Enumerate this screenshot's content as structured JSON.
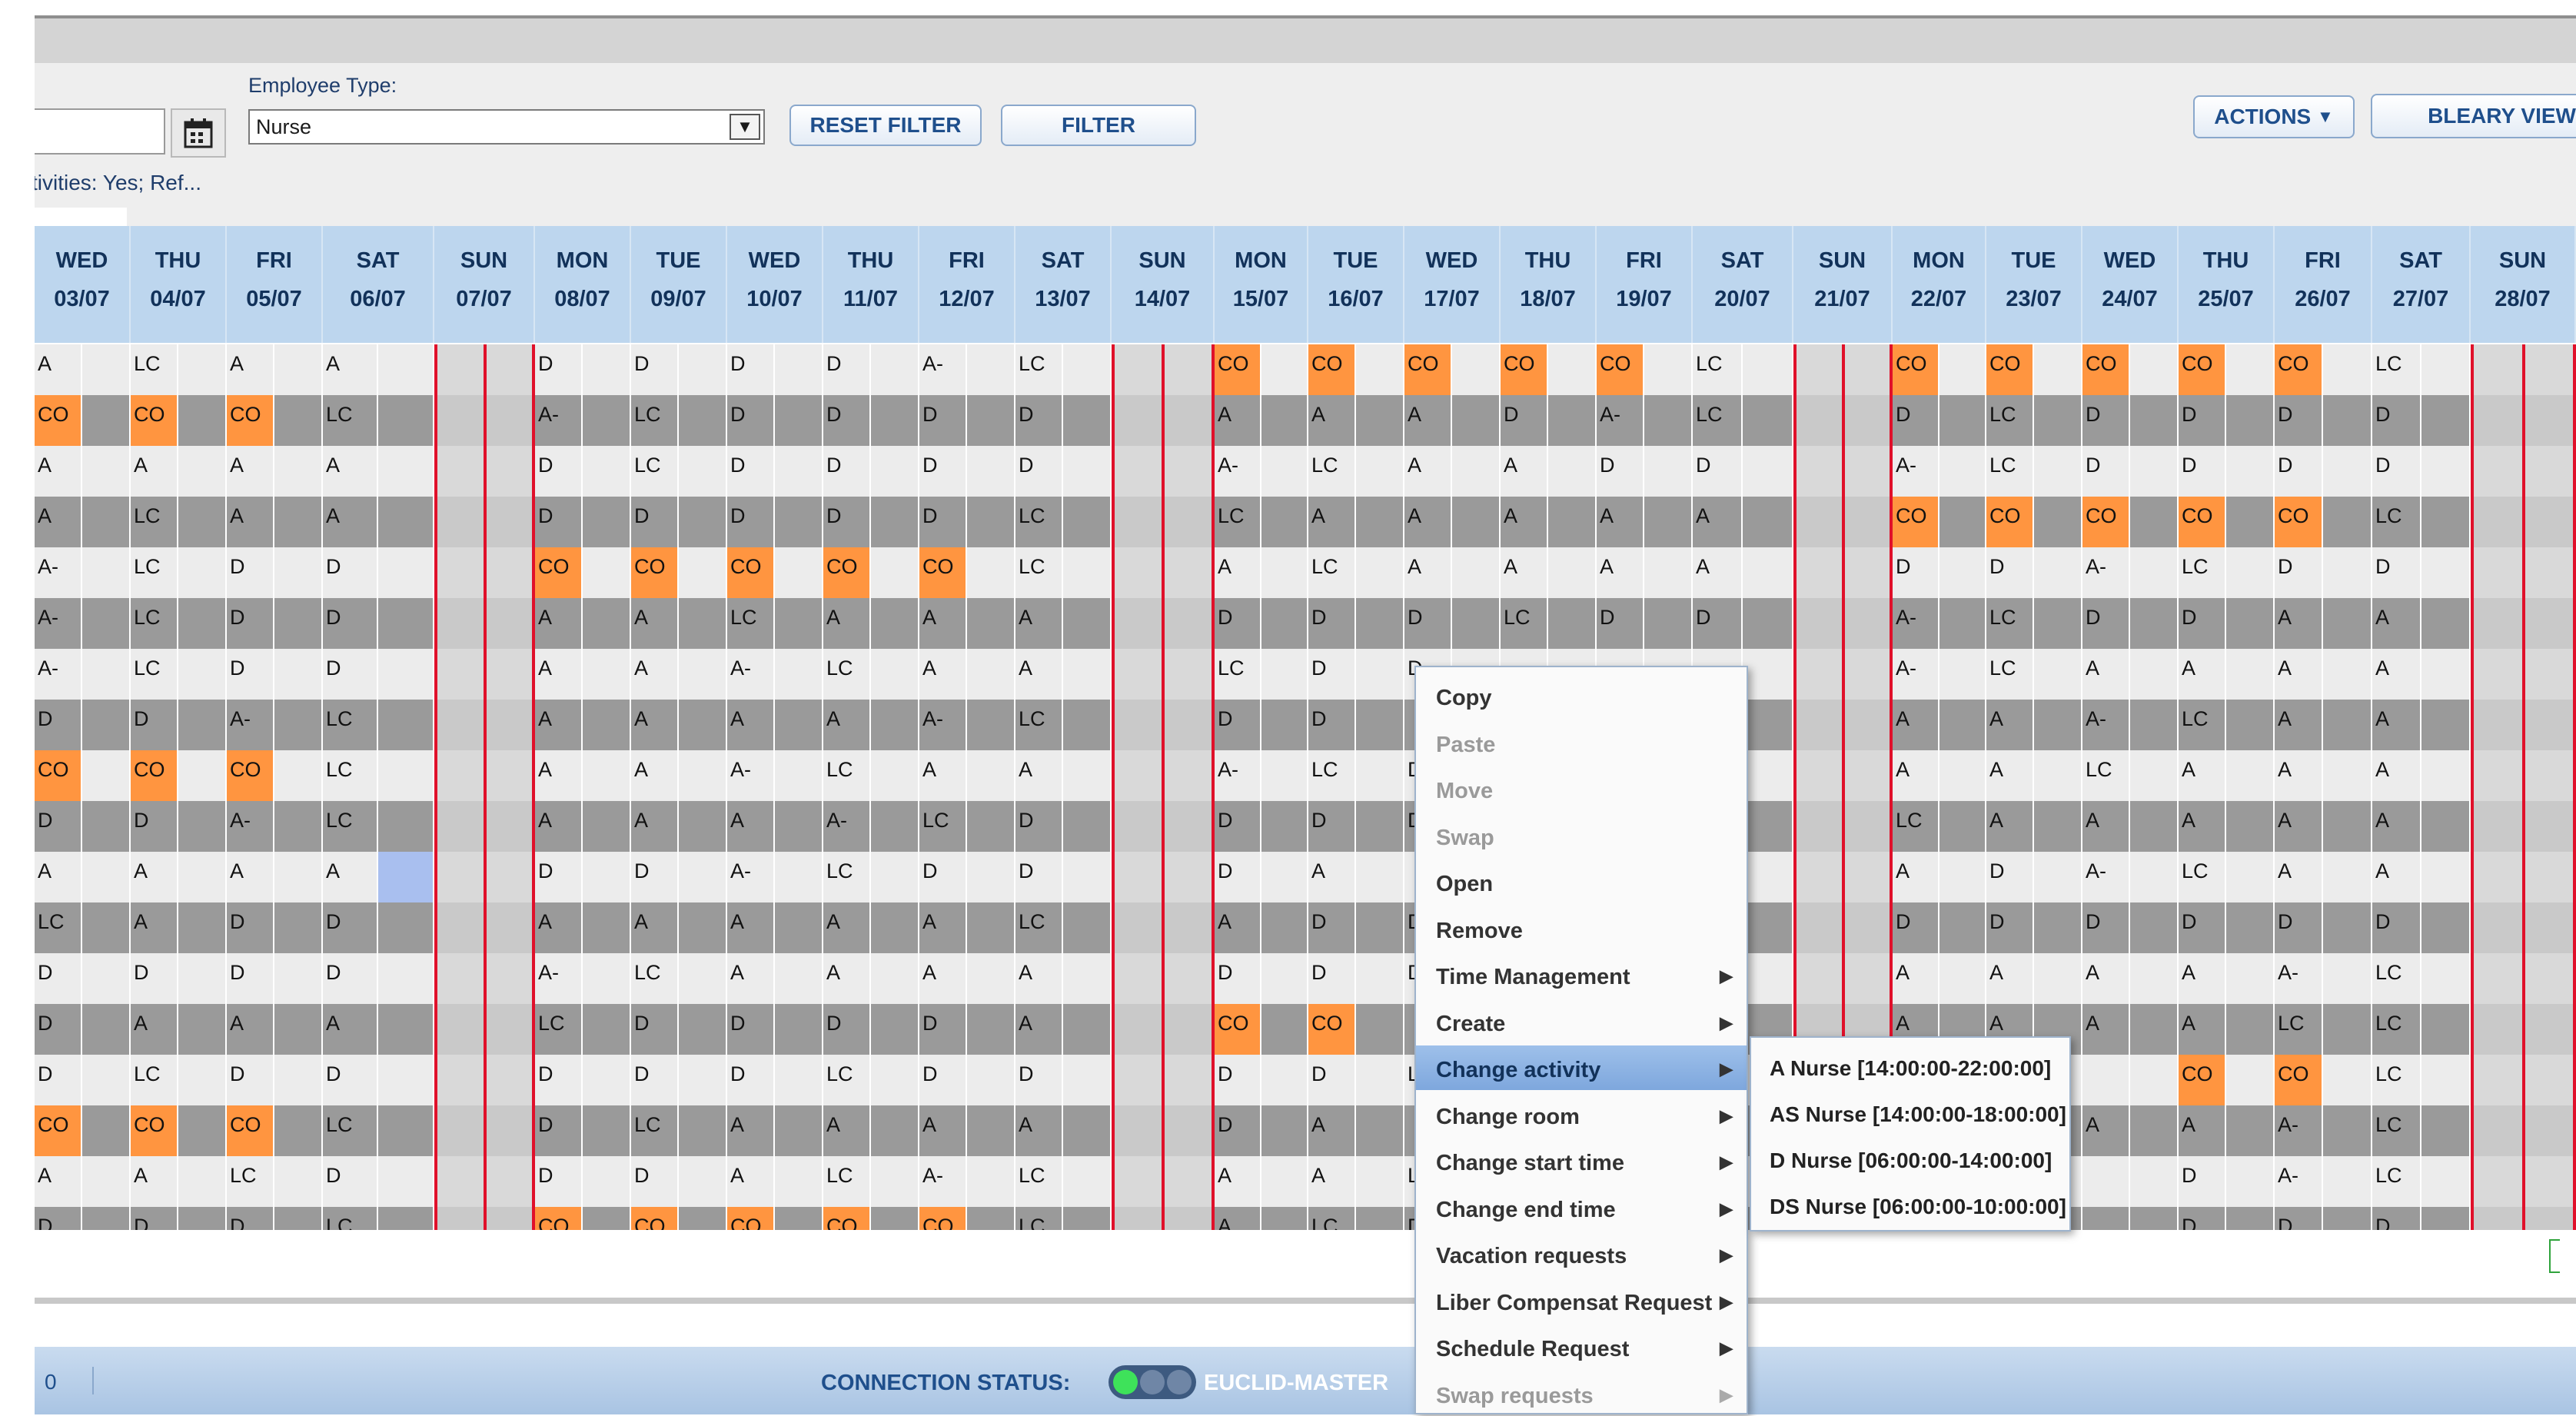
{
  "toolbar": {
    "employee_type_label": "Employee Type:",
    "employee_type_value": "Nurse",
    "reset_filter_label": "RESET FILTER",
    "filter_label": "FILTER",
    "actions_label": "ACTIONS",
    "bleary_view_label": "BLEARY VIEW",
    "filter_summary": "ctivities: Yes; Ref..."
  },
  "days": [
    {
      "dow": "WED",
      "date": "03/07"
    },
    {
      "dow": "THU",
      "date": "04/07"
    },
    {
      "dow": "FRI",
      "date": "05/07"
    },
    {
      "dow": "SAT",
      "date": "06/07"
    },
    {
      "dow": "SUN",
      "date": "07/07"
    },
    {
      "dow": "MON",
      "date": "08/07"
    },
    {
      "dow": "TUE",
      "date": "09/07"
    },
    {
      "dow": "WED",
      "date": "10/07"
    },
    {
      "dow": "THU",
      "date": "11/07"
    },
    {
      "dow": "FRI",
      "date": "12/07"
    },
    {
      "dow": "SAT",
      "date": "13/07"
    },
    {
      "dow": "SUN",
      "date": "14/07"
    },
    {
      "dow": "MON",
      "date": "15/07"
    },
    {
      "dow": "TUE",
      "date": "16/07"
    },
    {
      "dow": "WED",
      "date": "17/07"
    },
    {
      "dow": "THU",
      "date": "18/07"
    },
    {
      "dow": "FRI",
      "date": "19/07"
    },
    {
      "dow": "SAT",
      "date": "20/07"
    },
    {
      "dow": "SUN",
      "date": "21/07"
    },
    {
      "dow": "MON",
      "date": "22/07"
    },
    {
      "dow": "TUE",
      "date": "23/07"
    },
    {
      "dow": "WED",
      "date": "24/07"
    },
    {
      "dow": "THU",
      "date": "25/07"
    },
    {
      "dow": "FRI",
      "date": "26/07"
    },
    {
      "dow": "SAT",
      "date": "27/07"
    },
    {
      "dow": "SUN",
      "date": "28/07"
    }
  ],
  "schedule_rows": [
    [
      "  A",
      "LC",
      "  A",
      "  A",
      "",
      "D",
      "D",
      "D",
      "D",
      "A-",
      "LC",
      "",
      "CO",
      "CO",
      "CO",
      "CO",
      "CO",
      "LC",
      "",
      "CO",
      "CO",
      "CO",
      "CO",
      "CO",
      "LC",
      ""
    ],
    [
      "CO",
      "CO",
      "CO",
      "LC",
      "",
      "A-",
      "LC",
      "D",
      "D",
      "D",
      "D",
      "",
      "A",
      "A",
      "A",
      "D",
      "A-",
      "LC",
      "",
      "D",
      "LC",
      "D",
      "D",
      "D",
      "D",
      ""
    ],
    [
      "  A",
      "  A",
      "  A",
      "  A",
      "",
      "D",
      "LC",
      "D",
      "D",
      "D",
      "D",
      "",
      "A-",
      "LC",
      "A",
      "A",
      "D",
      "D",
      "",
      "A-",
      "LC",
      "D",
      "D",
      "D",
      "D",
      ""
    ],
    [
      "  A",
      "LC",
      "  A",
      "  A",
      "",
      "D",
      "D",
      "D",
      "D",
      "D",
      "LC",
      "",
      "LC",
      "A",
      "A",
      "A",
      "A",
      "A",
      "",
      "CO",
      "CO",
      "CO",
      "CO",
      "CO",
      "LC",
      ""
    ],
    [
      "A-",
      "LC",
      "D",
      "D",
      "",
      "CO",
      "CO",
      "CO",
      "CO",
      "CO",
      "LC",
      "",
      "A",
      "LC",
      "A",
      "A",
      "A",
      "A",
      "",
      "D",
      "D",
      "A-",
      "LC",
      "D",
      "D",
      ""
    ],
    [
      "A-",
      "LC",
      "D",
      "D",
      "",
      "A",
      "A",
      "LC",
      "A",
      "A",
      "A",
      "",
      "D",
      "D",
      "D",
      "LC",
      "D",
      "D",
      "",
      "A-",
      "LC",
      "D",
      "D",
      "A",
      "A",
      ""
    ],
    [
      "A-",
      "LC",
      "D",
      "D",
      "",
      "A",
      "A",
      "A-",
      "LC",
      "A",
      "A",
      "",
      "LC",
      "D",
      "D",
      "",
      "",
      "",
      "",
      "A-",
      "LC",
      "A",
      "A",
      "A",
      "A",
      ""
    ],
    [
      "D",
      "D",
      "A-",
      "LC",
      "",
      "A",
      "A",
      "A",
      "A",
      "A-",
      "LC",
      "",
      "D",
      "D",
      "",
      "",
      "",
      "",
      "",
      "A",
      "A",
      "A-",
      "LC",
      "A",
      "A",
      ""
    ],
    [
      "CO",
      "CO",
      "CO",
      "LC",
      "",
      "A",
      "A",
      "A-",
      "LC",
      "A",
      "A",
      "",
      "A-",
      "LC",
      "D",
      "",
      "",
      "",
      "",
      "A",
      "A",
      "LC",
      "A",
      "A",
      "A",
      ""
    ],
    [
      "D",
      "D",
      "A-",
      "LC",
      "",
      "A",
      "A",
      "A",
      "A-",
      "LC",
      "D",
      "",
      "D",
      "D",
      "D",
      "",
      "",
      "",
      "",
      "LC",
      "A",
      "A",
      "A",
      "A",
      "A",
      ""
    ],
    [
      "  A",
      "  A",
      "  A",
      "  A",
      "",
      "D",
      "D",
      "A-",
      "LC",
      "D",
      "D",
      "",
      "D",
      "A",
      "",
      "",
      "",
      "",
      "",
      "A",
      "D",
      "A-",
      "LC",
      "A",
      "A",
      ""
    ],
    [
      "  LC",
      "  A",
      "D",
      "D",
      "",
      "A",
      "A",
      "A",
      "A",
      "A",
      "LC",
      "",
      "A",
      "D",
      "D",
      "",
      "",
      "",
      "",
      "D",
      "D",
      "D",
      "D",
      "D",
      "D",
      ""
    ],
    [
      "D",
      "D",
      "D",
      "D",
      "",
      "A-",
      "LC",
      "A",
      "A",
      "A",
      "A",
      "",
      "D",
      "D",
      "D",
      "",
      "",
      "",
      "",
      "A",
      "A",
      "A",
      "A",
      "A-",
      "LC",
      ""
    ],
    [
      "D",
      "  A",
      "  A",
      "  A",
      "",
      "LC",
      "D",
      "D",
      "D",
      "D",
      "A",
      "",
      "CO",
      "CO",
      "",
      "",
      "",
      "",
      "",
      "A",
      "A",
      "A",
      "A",
      "LC",
      "LC",
      ""
    ],
    [
      "D",
      "LC",
      "D",
      "D",
      "",
      "D",
      "D",
      "D",
      "LC",
      "D",
      "D",
      "",
      "D",
      "D",
      "L",
      "",
      "",
      "",
      "",
      "",
      "",
      "",
      "CO",
      "CO",
      "LC",
      ""
    ],
    [
      "CO",
      "CO",
      "CO",
      "LC",
      "",
      "D",
      "LC",
      "A",
      "A",
      "A",
      "A",
      "",
      "D",
      "A",
      "",
      "",
      "",
      "",
      "",
      "",
      "",
      "A",
      "A",
      "A-",
      "LC",
      ""
    ],
    [
      "  A",
      "  A",
      "LC",
      "D",
      "",
      "D",
      "D",
      "A",
      "LC",
      "A-",
      "LC",
      "",
      "A",
      "A",
      "L",
      "",
      "",
      "",
      "",
      "",
      "",
      "",
      "D",
      "A-",
      "LC",
      ""
    ],
    [
      "D",
      "D",
      "D",
      "LC",
      "",
      "CO",
      "CO",
      "CO",
      "CO",
      "CO",
      "LC",
      "",
      "A",
      "LC",
      "D",
      "",
      "",
      "",
      "",
      "",
      "",
      "",
      "D",
      "D",
      "D",
      ""
    ]
  ],
  "context_menu": {
    "items": [
      {
        "label": "Copy",
        "disabled": false,
        "submenu": false,
        "highlight": false
      },
      {
        "label": "Paste",
        "disabled": true,
        "submenu": false,
        "highlight": false
      },
      {
        "label": "Move",
        "disabled": true,
        "submenu": false,
        "highlight": false
      },
      {
        "label": "Swap",
        "disabled": true,
        "submenu": false,
        "highlight": false
      },
      {
        "label": "Open",
        "disabled": false,
        "submenu": false,
        "highlight": false
      },
      {
        "label": "Remove",
        "disabled": false,
        "submenu": false,
        "highlight": false
      },
      {
        "label": "Time Management",
        "disabled": false,
        "submenu": true,
        "highlight": false
      },
      {
        "label": "Create",
        "disabled": false,
        "submenu": true,
        "highlight": false
      },
      {
        "label": "Change activity",
        "disabled": false,
        "submenu": true,
        "highlight": true
      },
      {
        "label": "Change room",
        "disabled": false,
        "submenu": true,
        "highlight": false
      },
      {
        "label": "Change start time",
        "disabled": false,
        "submenu": true,
        "highlight": false
      },
      {
        "label": "Change end time",
        "disabled": false,
        "submenu": true,
        "highlight": false
      },
      {
        "label": "Vacation requests",
        "disabled": false,
        "submenu": true,
        "highlight": false
      },
      {
        "label": "Liber Compensat Request",
        "disabled": false,
        "submenu": true,
        "highlight": false
      },
      {
        "label": "Schedule Request",
        "disabled": false,
        "submenu": true,
        "highlight": false
      },
      {
        "label": "Swap requests",
        "disabled": true,
        "submenu": true,
        "highlight": false
      }
    ]
  },
  "activity_submenu": [
    "A Nurse [14:00:00-22:00:00]",
    "AS Nurse [14:00:00-18:00:00]",
    "D Nurse [06:00:00-14:00:00]",
    "DS Nurse [06:00:00-10:00:00]"
  ],
  "status_bar": {
    "count": "0",
    "connection_label": "CONNECTION STATUS:",
    "server_name": "EUCLID-MASTER"
  },
  "colors": {
    "accent": "#1f4f8c",
    "header_bg": "#bdd6ee",
    "compensation_off": "#ff9540",
    "sunday_border": "#e0102a",
    "menu_highlight": "#8fb4e4"
  },
  "icons": {
    "calendar": "calendar-icon",
    "dropdown": "chevron-down-icon",
    "submenu_arrow": "triangle-right-icon"
  }
}
